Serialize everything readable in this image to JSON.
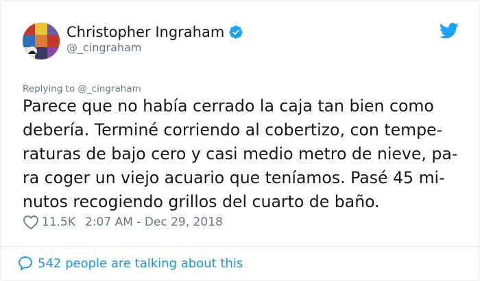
{
  "tweet": {
    "author_name": "Christopher Ingraham",
    "author_handle": "@_cingraham",
    "replying_to": "Replying to @_cingraham",
    "text_lines": [
      "Parece que no había cerrado la caja tan bien como",
      "debería. Terminé corriendo al cobertizo, con tempe-",
      "raturas de bajo cero y casi medio metro de nieve, pa-",
      "ra coger un viejo acuario que teníamos. Pasé 45 mi-",
      "nutos recogiendo grillos del cuarto de baño."
    ],
    "likes": "11.5K",
    "timestamp": "2:07 AM - Dec 29, 2018",
    "conversation": "542 people are talking about this"
  },
  "colors": {
    "twitter_blue": "#1da1f2",
    "link_blue": "#1b95e0",
    "muted_gray": "#657786",
    "text_dark": "#14171a"
  },
  "icons": {
    "avatar": "avatar",
    "verified": "verified-badge-icon",
    "bird": "twitter-bird-icon",
    "heart": "heart-icon",
    "bubble": "reply-bubble-icon"
  }
}
